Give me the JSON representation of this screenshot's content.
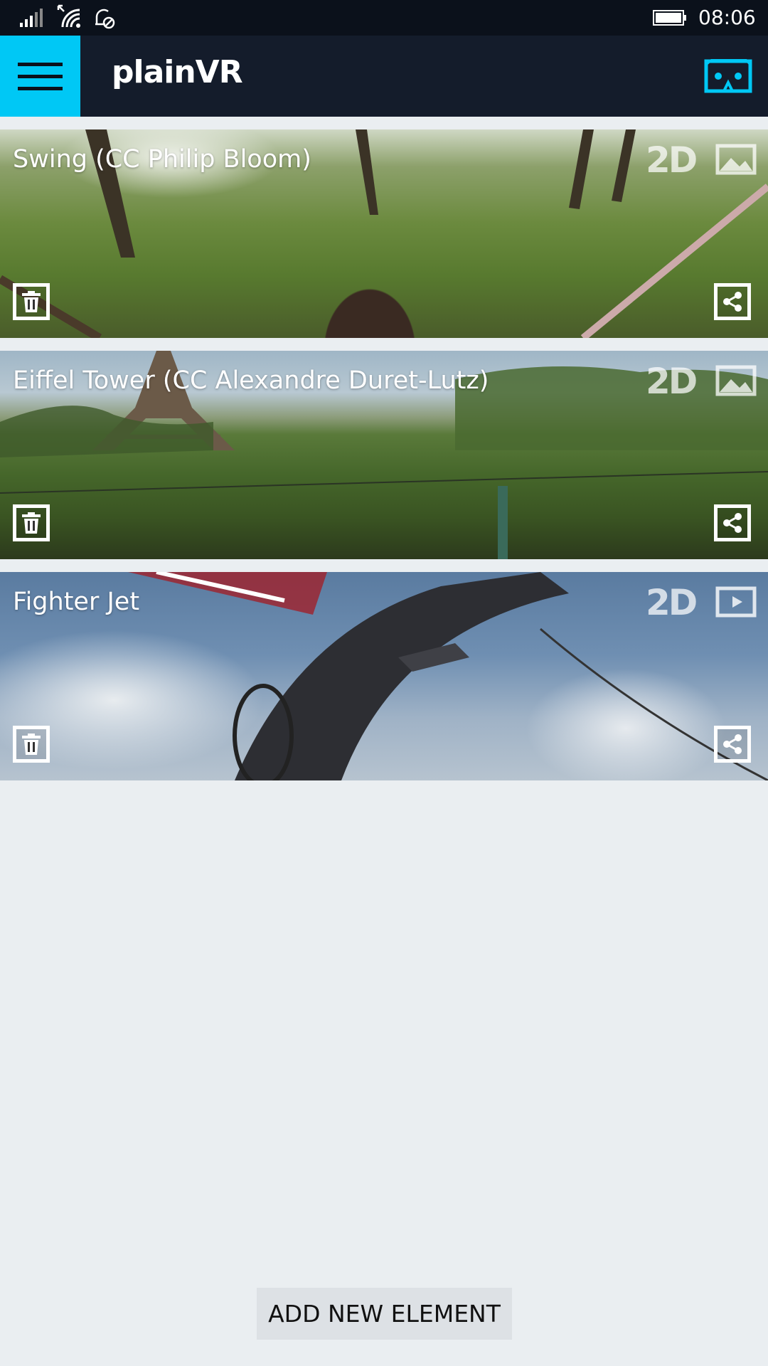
{
  "status_bar": {
    "time": "08:06",
    "icons": [
      "signal-icon",
      "wifi-icon",
      "alarm-off-icon",
      "battery-icon"
    ]
  },
  "header": {
    "app_title": "plainVR",
    "menu_icon": "hamburger-icon",
    "vr_icon": "vr-headset-icon",
    "accent": "#00c8f5"
  },
  "items": [
    {
      "title": "Swing (CC Philip Bloom)",
      "badge": "2D",
      "media_type": "image"
    },
    {
      "title": "Eiffel Tower (CC Alexandre Duret-Lutz)",
      "badge": "2D",
      "media_type": "image"
    },
    {
      "title": "Fighter Jet",
      "badge": "2D",
      "media_type": "video"
    }
  ],
  "add_button": {
    "label": "ADD NEW ELEMENT"
  }
}
